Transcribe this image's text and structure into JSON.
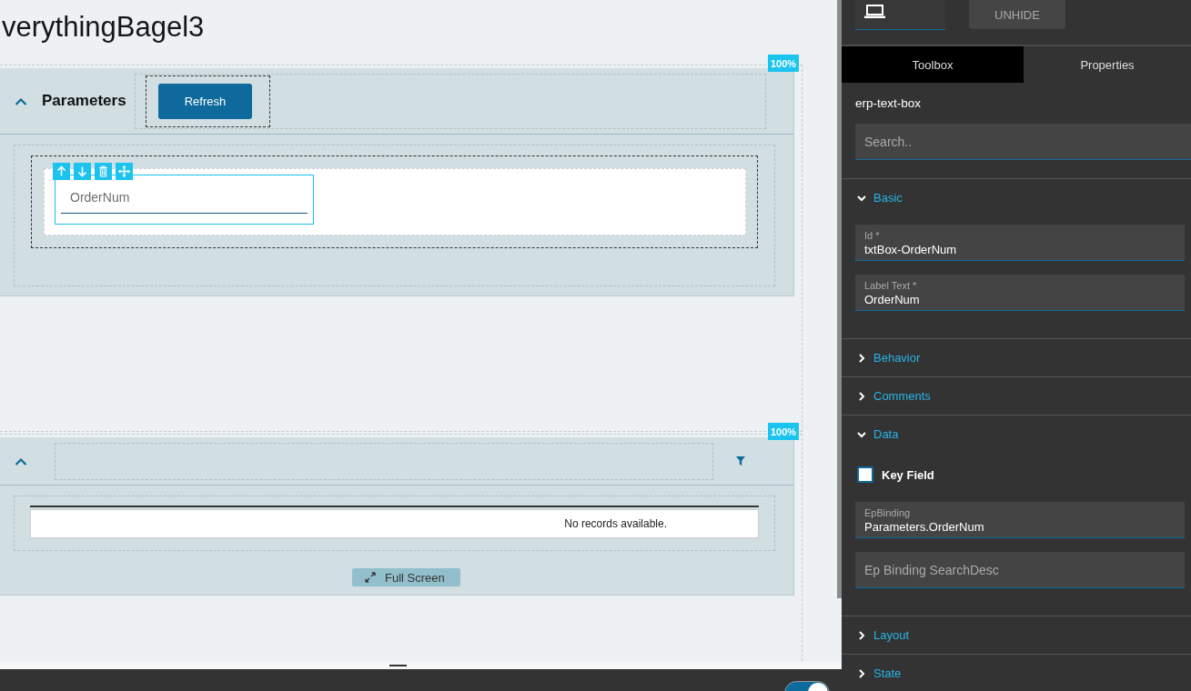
{
  "canvas": {
    "title": "verythingBagel3",
    "panels": [
      {
        "kind": "parameters",
        "zoom_badge": "100%",
        "expanded": true,
        "title": "Parameters",
        "button": "Refresh",
        "text_box": {
          "placeholder": "OrderNum",
          "selected": true
        }
      },
      {
        "kind": "grid",
        "zoom_badge": "100%",
        "expanded": true,
        "empty_message": "No records available.",
        "button": "Full Screen"
      }
    ]
  },
  "bottom_bar": {
    "toggle": {
      "on": true
    }
  },
  "side_panel": {
    "unhide_button": "UNHIDE",
    "tabs": [
      {
        "label": "Toolbox",
        "selected": true
      },
      {
        "label": "Properties",
        "selected": false
      }
    ],
    "component": "erp-text-box",
    "search": {
      "placeholder": "Search.."
    },
    "sections": [
      {
        "title": "Basic",
        "expanded": true,
        "fields": [
          {
            "kind": "text",
            "label": "Id *",
            "value": "txtBox-OrderNum"
          },
          {
            "kind": "text",
            "label": "Label Text *",
            "value": "OrderNum"
          }
        ]
      },
      {
        "title": "Behavior",
        "expanded": false
      },
      {
        "title": "Comments",
        "expanded": false
      },
      {
        "title": "Data",
        "expanded": true,
        "fields": [
          {
            "kind": "checkbox",
            "label": "Key Field",
            "checked": false
          },
          {
            "kind": "text",
            "label": "EpBinding",
            "value": "Parameters.OrderNum"
          },
          {
            "kind": "text",
            "placeholder": "Ep Binding SearchDesc"
          }
        ]
      },
      {
        "title": "Layout",
        "expanded": false
      },
      {
        "title": "State",
        "expanded": false
      }
    ]
  }
}
